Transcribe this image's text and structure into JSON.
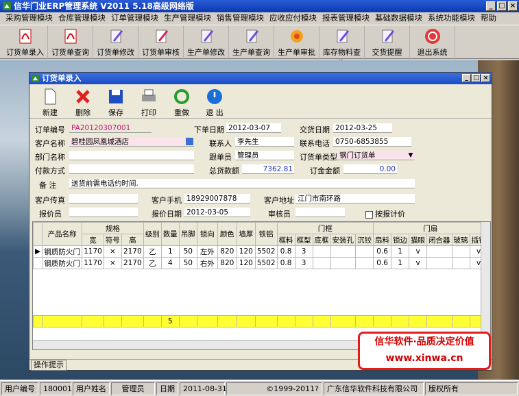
{
  "app": {
    "title": "信华门业ERP管理系统  V2011  5.18高级网络版"
  },
  "menu": [
    "采购管理模块",
    "仓库管理模块",
    "订单管理模块",
    "生产管理模块",
    "销售管理模块",
    "应收应付模块",
    "报表管理模块",
    "基础数据模块",
    "系统功能模块",
    "帮助"
  ],
  "toolbar": [
    {
      "label": "订货单录入",
      "icon": "pdf-icon"
    },
    {
      "label": "订货单查询",
      "icon": "pdf-icon"
    },
    {
      "label": "订货单修改",
      "icon": "pen-icon"
    },
    {
      "label": "订货单审核",
      "icon": "stamp-icon"
    },
    {
      "label": "生产单修改",
      "icon": "pen-icon"
    },
    {
      "label": "生产单查询",
      "icon": "pen-icon"
    },
    {
      "label": "生产单审批",
      "icon": "flower-icon"
    },
    {
      "label": "库存物料查询",
      "icon": "pen-icon"
    },
    {
      "label": "交货提醒",
      "icon": "pen-icon"
    },
    {
      "label": "退出系统",
      "icon": "power-icon"
    }
  ],
  "dialog": {
    "title": "订货单录入",
    "tools": [
      "新建",
      "删除",
      "保存",
      "打印",
      "重做",
      "退 出"
    ],
    "labels": {
      "order_no": "订单编号",
      "order_date": "下单日期",
      "delivery_date": "交货日期",
      "customer": "客户名称",
      "contact": "联系人",
      "contact_phone": "联系电话",
      "dept": "部门名称",
      "follower": "跟单员",
      "order_type": "订货单类型",
      "payment": "付款方式",
      "total": "总货款额",
      "deposit": "订金金额",
      "remark": "备  注",
      "fax": "客户传真",
      "mobile": "客户手机",
      "address": "客户地址",
      "quoter": "报价员",
      "quote_date": "报价日期",
      "auditor": "审核员",
      "quote_chk": "按报计价"
    },
    "values": {
      "order_no": "PA20120307001",
      "order_date": "2012-03-07",
      "delivery_date": "2012-03-25",
      "customer": "碧桂园凤凰城酒店",
      "contact": "李先生",
      "contact_phone": "0750-6853855",
      "dept": "",
      "follower": "管理员",
      "order_type": "钢门订货单",
      "payment": "",
      "total": "7362.81",
      "deposit": "0.00",
      "remark": "送货前需电话约时间.",
      "fax": "",
      "mobile": "18929007878",
      "address": "江门市南环路",
      "quoter": "",
      "quote_date": "2012-03-05",
      "auditor": ""
    },
    "grid": {
      "group_headers": {
        "spec": "规格",
        "frame": "门框",
        "leaf": "门扇"
      },
      "headers": [
        "产品名称",
        "宽",
        "符号",
        "高",
        "级别",
        "数量",
        "吊脚",
        "锁向",
        "颜色",
        "墙厚",
        "铁铝",
        "框料",
        "框型",
        "底框",
        "安装孔",
        "沉铰",
        "扇料",
        "锁边",
        "猫眼",
        "闭合器",
        "玻璃",
        "插销"
      ],
      "rows": [
        [
          "钢质防火门",
          "1170",
          "×",
          "2170",
          "乙",
          "1",
          "50",
          "左外",
          "820",
          "120",
          "5502",
          "0.8",
          "3",
          "",
          "",
          "",
          "0.6",
          "1",
          "v",
          "",
          "",
          "v"
        ],
        [
          "钢质防火门",
          "1170",
          "×",
          "2170",
          "乙",
          "4",
          "50",
          "右外",
          "820",
          "120",
          "5502",
          "0.8",
          "3",
          "",
          "",
          "",
          "0.6",
          "1",
          "v",
          "",
          "",
          "v"
        ]
      ],
      "total_qty": "5"
    },
    "ops_tab": "操作提示"
  },
  "ad": {
    "line1": "信华软件·品质决定价值",
    "line2": "www.xinwa.cn"
  },
  "status": {
    "user_no_label": "用户编号",
    "user_no": "180001",
    "user_name_label": "用户姓名",
    "user_name": "管理员",
    "date_label": "日期",
    "date": "2011-08-31",
    "copyright": "©1999-2011?",
    "company": "广东信华软件科技有限公司",
    "rights": "版权所有"
  }
}
